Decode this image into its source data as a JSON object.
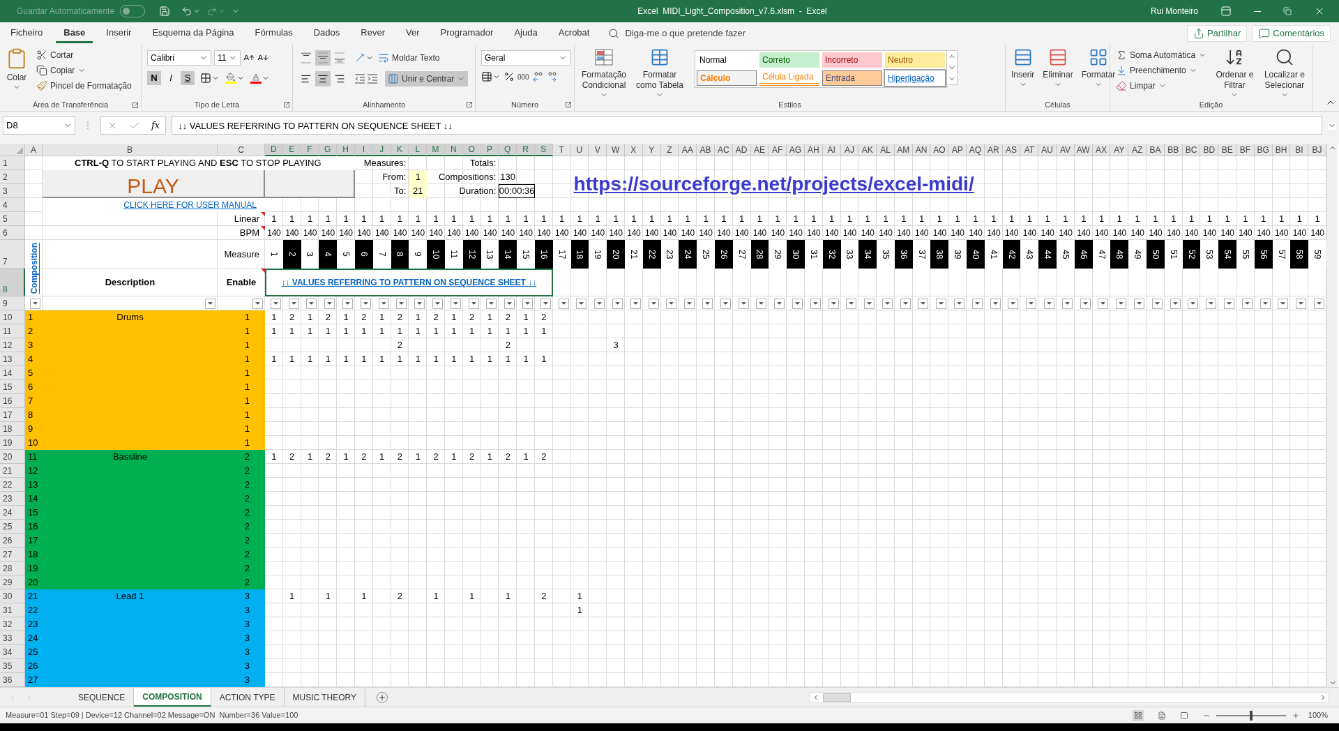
{
  "window": {
    "autosave_label": "Guardar Automaticamente",
    "autosave_on": false,
    "title": "Excel  MIDI_Light_Composition_v7.6.xlsm  -  Excel",
    "user": "Rui Monteiro"
  },
  "menu_tabs": [
    {
      "label": "Ficheiro",
      "selected": false
    },
    {
      "label": "Base",
      "selected": true
    },
    {
      "label": "Inserir",
      "selected": false
    },
    {
      "label": "Esquema da Página",
      "selected": false
    },
    {
      "label": "Fórmulas",
      "selected": false
    },
    {
      "label": "Dados",
      "selected": false
    },
    {
      "label": "Rever",
      "selected": false
    },
    {
      "label": "Ver",
      "selected": false
    },
    {
      "label": "Programador",
      "selected": false
    },
    {
      "label": "Ajuda",
      "selected": false
    },
    {
      "label": "Acrobat",
      "selected": false
    }
  ],
  "tell_me": {
    "placeholder": "Diga-me o que pretende fazer"
  },
  "share_button": "Partilhar",
  "comments_button": "Comentários",
  "ribbon": {
    "clipboard": {
      "title": "Área de Transferência",
      "paste": "Colar",
      "cut": "Cortar",
      "copy": "Copiar",
      "format_painter": "Pincel de Formatação"
    },
    "font": {
      "title": "Tipo de Letra",
      "family": "Calibri",
      "size": "11",
      "bold": "N",
      "bold_on": true,
      "italic": "I",
      "italic_on": false,
      "underline": "S",
      "underline_on": true
    },
    "alignment": {
      "title": "Alinhamento",
      "vertical": [
        {
          "kind": "top",
          "selected": false
        },
        {
          "kind": "middle",
          "selected": true
        },
        {
          "kind": "bottom",
          "selected": false
        }
      ],
      "horizontal": [
        {
          "kind": "left",
          "selected": false
        },
        {
          "kind": "center",
          "selected": true
        },
        {
          "kind": "right",
          "selected": false
        }
      ],
      "wrap": "Moldar Texto",
      "merge": "Unir e Centrar",
      "merge_on": true
    },
    "number": {
      "title": "Número",
      "format": "Geral",
      "thousands": "000"
    },
    "styles": {
      "title": "Estilos",
      "conditional": "Formatação Condicional",
      "as_table": "Formatar como Tabela",
      "gallery": [
        {
          "label": "Normal",
          "kind": "normal",
          "selected": false
        },
        {
          "label": "Correto",
          "kind": "good",
          "selected": false
        },
        {
          "label": "Incorreto",
          "kind": "bad",
          "selected": false
        },
        {
          "label": "Neutro",
          "kind": "neutral",
          "selected": false
        },
        {
          "label": "Cálculo",
          "kind": "calculation",
          "selected": false
        },
        {
          "label": "Célula Ligada",
          "kind": "linked",
          "selected": false
        },
        {
          "label": "Entrada",
          "kind": "input",
          "selected": false
        },
        {
          "label": "Hiperligação",
          "kind": "hyperlink",
          "selected": true
        }
      ]
    },
    "cells": {
      "title": "Células",
      "insert": "Inserir",
      "delete": "Eliminar",
      "format": "Formatar"
    },
    "editing": {
      "title": "Edição",
      "autosum": "Soma Automática",
      "fill": "Preenchimento",
      "clear": "Limpar",
      "sort": "Ordenar e Filtrar",
      "find": "Localizar e Selecionar"
    }
  },
  "formula_bar": {
    "name_box": "D8",
    "function_button": "fx",
    "value": "↓↓ VALUES REFERRING TO PATTERN ON SEQUENCE SHEET ↓↓"
  },
  "columns": [
    {
      "label": "A",
      "selected": false
    },
    {
      "label": "B",
      "selected": false
    },
    {
      "label": "C",
      "selected": false
    },
    {
      "label": "D",
      "selected": true
    },
    {
      "label": "E",
      "selected": true
    },
    {
      "label": "F",
      "selected": true
    },
    {
      "label": "G",
      "selected": true
    },
    {
      "label": "H",
      "selected": true
    },
    {
      "label": "I",
      "selected": true
    },
    {
      "label": "J",
      "selected": true
    },
    {
      "label": "K",
      "selected": true
    },
    {
      "label": "L",
      "selected": true
    },
    {
      "label": "M",
      "selected": true
    },
    {
      "label": "N",
      "selected": true
    },
    {
      "label": "O",
      "selected": true
    },
    {
      "label": "P",
      "selected": true
    },
    {
      "label": "Q",
      "selected": true
    },
    {
      "label": "R",
      "selected": true
    },
    {
      "label": "S",
      "selected": true
    },
    {
      "label": "T",
      "selected": false
    },
    {
      "label": "U",
      "selected": false
    },
    {
      "label": "V",
      "selected": false
    },
    {
      "label": "W",
      "selected": false
    },
    {
      "label": "X",
      "selected": false
    },
    {
      "label": "Y",
      "selected": false
    },
    {
      "label": "Z",
      "selected": false
    },
    {
      "label": "AA",
      "selected": false
    },
    {
      "label": "AB",
      "selected": false
    },
    {
      "label": "AC",
      "selected": false
    },
    {
      "label": "AD",
      "selected": false
    },
    {
      "label": "AE",
      "selected": false
    },
    {
      "label": "AF",
      "selected": false
    },
    {
      "label": "AG",
      "selected": false
    },
    {
      "label": "AH",
      "selected": false
    },
    {
      "label": "AI",
      "selected": false
    },
    {
      "label": "AJ",
      "selected": false
    },
    {
      "label": "AK",
      "selected": false
    },
    {
      "label": "AL",
      "selected": false
    },
    {
      "label": "AM",
      "selected": false
    },
    {
      "label": "AN",
      "selected": false
    },
    {
      "label": "AO",
      "selected": false
    },
    {
      "label": "AP",
      "selected": false
    },
    {
      "label": "AQ",
      "selected": false
    },
    {
      "label": "AR",
      "selected": false
    },
    {
      "label": "AS",
      "selected": false
    },
    {
      "label": "AT",
      "selected": false
    },
    {
      "label": "AU",
      "selected": false
    },
    {
      "label": "AV",
      "selected": false
    },
    {
      "label": "AW",
      "selected": false
    },
    {
      "label": "AX",
      "selected": false
    },
    {
      "label": "AY",
      "selected": false
    },
    {
      "label": "AZ",
      "selected": false
    },
    {
      "label": "BA",
      "selected": false
    },
    {
      "label": "BB",
      "selected": false
    },
    {
      "label": "BC",
      "selected": false
    },
    {
      "label": "BD",
      "selected": false
    },
    {
      "label": "BE",
      "selected": false
    },
    {
      "label": "BF",
      "selected": false
    },
    {
      "label": "BG",
      "selected": false
    },
    {
      "label": "BH",
      "selected": false
    },
    {
      "label": "BI",
      "selected": false
    },
    {
      "label": "BJ",
      "selected": false
    }
  ],
  "row_numbers": [
    {
      "label": "1",
      "selected": false
    },
    {
      "label": "2",
      "selected": false
    },
    {
      "label": "3",
      "selected": false
    },
    {
      "label": "4",
      "selected": false
    },
    {
      "label": "5",
      "selected": false
    },
    {
      "label": "6",
      "selected": false
    },
    {
      "label": "7",
      "selected": false
    },
    {
      "label": "8",
      "selected": true
    },
    {
      "label": "9",
      "selected": false
    },
    {
      "label": "10",
      "selected": false
    },
    {
      "label": "11",
      "selected": false
    },
    {
      "label": "12",
      "selected": false
    },
    {
      "label": "13",
      "selected": false
    },
    {
      "label": "14",
      "selected": false
    },
    {
      "label": "15",
      "selected": false
    },
    {
      "label": "16",
      "selected": false
    },
    {
      "label": "17",
      "selected": false
    },
    {
      "label": "18",
      "selected": false
    },
    {
      "label": "19",
      "selected": false
    },
    {
      "label": "20",
      "selected": false
    },
    {
      "label": "21",
      "selected": false
    },
    {
      "label": "22",
      "selected": false
    },
    {
      "label": "23",
      "selected": false
    },
    {
      "label": "24",
      "selected": false
    },
    {
      "label": "25",
      "selected": false
    },
    {
      "label": "26",
      "selected": false
    },
    {
      "label": "27",
      "selected": false
    },
    {
      "label": "28",
      "selected": false
    },
    {
      "label": "29",
      "selected": false
    },
    {
      "label": "30",
      "selected": false
    },
    {
      "label": "31",
      "selected": false
    },
    {
      "label": "32",
      "selected": false
    },
    {
      "label": "33",
      "selected": false
    },
    {
      "label": "34",
      "selected": false
    },
    {
      "label": "35",
      "selected": false
    },
    {
      "label": "36",
      "selected": false
    }
  ],
  "sheet": {
    "instruction": "**CTRL-Q** TO START PLAYING AND **ESC** TO STOP PLAYING",
    "play_button": "PLAY",
    "manual_link": "CLICK HERE FOR USER MANUAL",
    "url_link": "https://sourceforge.net/projects/excel-midi/",
    "measures_label": "Measures:",
    "from_label": "From:",
    "from_value": "1",
    "to_label": "To:",
    "to_value": "21",
    "totals_label": "Totals:",
    "compositions_label": "Compositions:",
    "compositions_value": "130",
    "duration_label": "Duration:",
    "duration_value": "00:00:36",
    "linear_label": "Linear",
    "bpm_label": "BPM",
    "measure_label": "Measure",
    "composition_link": "Composition",
    "description_header": "Description",
    "enable_header": "Enable",
    "pattern_note": "↓↓ VALUES REFERRING TO PATTERN ON SEQUENCE SHEET ↓↓",
    "linear": [
      "1",
      "1",
      "1",
      "1",
      "1",
      "1",
      "1",
      "1",
      "1",
      "1",
      "1",
      "1",
      "1",
      "1",
      "1",
      "1",
      "1",
      "1",
      "1",
      "1",
      "1",
      "1",
      "1",
      "1",
      "1",
      "1",
      "1",
      "1",
      "1",
      "1",
      "1",
      "1",
      "1",
      "1",
      "1",
      "1",
      "1",
      "1",
      "1",
      "1",
      "1",
      "1",
      "1",
      "1",
      "1",
      "1",
      "1",
      "1",
      "1",
      "1",
      "1",
      "1",
      "1",
      "1",
      "1",
      "1",
      "1",
      "1",
      "1"
    ],
    "bpm": [
      "140",
      "140",
      "140",
      "140",
      "140",
      "140",
      "140",
      "140",
      "140",
      "140",
      "140",
      "140",
      "140",
      "140",
      "140",
      "140",
      "140",
      "140",
      "140",
      "140",
      "140",
      "140",
      "140",
      "140",
      "140",
      "140",
      "140",
      "140",
      "140",
      "140",
      "140",
      "140",
      "140",
      "140",
      "140",
      "140",
      "140",
      "140",
      "140",
      "140",
      "140",
      "140",
      "140",
      "140",
      "140",
      "140",
      "140",
      "140",
      "140",
      "140",
      "140",
      "140",
      "140",
      "140",
      "140",
      "140",
      "140",
      "140",
      "140"
    ],
    "measures": [
      {
        "label": "1",
        "dark": false
      },
      {
        "label": "2",
        "dark": true
      },
      {
        "label": "3",
        "dark": false
      },
      {
        "label": "4",
        "dark": true
      },
      {
        "label": "5",
        "dark": false
      },
      {
        "label": "6",
        "dark": true
      },
      {
        "label": "7",
        "dark": false
      },
      {
        "label": "8",
        "dark": true
      },
      {
        "label": "9",
        "dark": false
      },
      {
        "label": "10",
        "dark": true
      },
      {
        "label": "11",
        "dark": false
      },
      {
        "label": "12",
        "dark": true
      },
      {
        "label": "13",
        "dark": false
      },
      {
        "label": "14",
        "dark": true
      },
      {
        "label": "15",
        "dark": false
      },
      {
        "label": "16",
        "dark": true
      },
      {
        "label": "17",
        "dark": false
      },
      {
        "label": "18",
        "dark": true
      },
      {
        "label": "19",
        "dark": false
      },
      {
        "label": "20",
        "dark": true
      },
      {
        "label": "21",
        "dark": false
      },
      {
        "label": "22",
        "dark": true
      },
      {
        "label": "23",
        "dark": false
      },
      {
        "label": "24",
        "dark": true
      },
      {
        "label": "25",
        "dark": false
      },
      {
        "label": "26",
        "dark": true
      },
      {
        "label": "27",
        "dark": false
      },
      {
        "label": "28",
        "dark": true
      },
      {
        "label": "29",
        "dark": false
      },
      {
        "label": "30",
        "dark": true
      },
      {
        "label": "31",
        "dark": false
      },
      {
        "label": "32",
        "dark": true
      },
      {
        "label": "33",
        "dark": false
      },
      {
        "label": "34",
        "dark": true
      },
      {
        "label": "35",
        "dark": false
      },
      {
        "label": "36",
        "dark": true
      },
      {
        "label": "37",
        "dark": false
      },
      {
        "label": "38",
        "dark": true
      },
      {
        "label": "39",
        "dark": false
      },
      {
        "label": "40",
        "dark": true
      },
      {
        "label": "41",
        "dark": false
      },
      {
        "label": "42",
        "dark": true
      },
      {
        "label": "43",
        "dark": false
      },
      {
        "label": "44",
        "dark": true
      },
      {
        "label": "45",
        "dark": false
      },
      {
        "label": "46",
        "dark": true
      },
      {
        "label": "47",
        "dark": false
      },
      {
        "label": "48",
        "dark": true
      },
      {
        "label": "49",
        "dark": false
      },
      {
        "label": "50",
        "dark": true
      },
      {
        "label": "51",
        "dark": false
      },
      {
        "label": "52",
        "dark": true
      },
      {
        "label": "53",
        "dark": false
      },
      {
        "label": "54",
        "dark": true
      },
      {
        "label": "55",
        "dark": false
      },
      {
        "label": "56",
        "dark": true
      },
      {
        "label": "57",
        "dark": false
      },
      {
        "label": "58",
        "dark": true
      },
      {
        "label": "59",
        "dark": false
      }
    ],
    "tracks": [
      {
        "number": "1",
        "description": "Drums",
        "enable": "1",
        "color": "#ffc000",
        "cells": [
          "1",
          "2",
          "1",
          "2",
          "1",
          "2",
          "1",
          "2",
          "1",
          "2",
          "1",
          "2",
          "1",
          "2",
          "1",
          "2"
        ]
      },
      {
        "number": "2",
        "enable": "1",
        "color": "#ffc000",
        "cells": [
          "1",
          "1",
          "1",
          "1",
          "1",
          "1",
          "1",
          "1",
          "1",
          "1",
          "1",
          "1",
          "1",
          "1",
          "1",
          "1"
        ]
      },
      {
        "number": "3",
        "enable": "1",
        "color": "#ffc000",
        "cells": [
          null,
          null,
          null,
          null,
          null,
          null,
          null,
          "2",
          null,
          null,
          null,
          null,
          null,
          "2",
          null,
          null,
          null,
          null,
          null,
          "3"
        ]
      },
      {
        "number": "4",
        "enable": "1",
        "color": "#ffc000",
        "cells": [
          "1",
          "1",
          "1",
          "1",
          "1",
          "1",
          "1",
          "1",
          "1",
          "1",
          "1",
          "1",
          "1",
          "1",
          "1",
          "1"
        ]
      },
      {
        "number": "5",
        "enable": "1",
        "color": "#ffc000"
      },
      {
        "number": "6",
        "enable": "1",
        "color": "#ffc000"
      },
      {
        "number": "7",
        "enable": "1",
        "color": "#ffc000"
      },
      {
        "number": "8",
        "enable": "1",
        "color": "#ffc000"
      },
      {
        "number": "9",
        "enable": "1",
        "color": "#ffc000"
      },
      {
        "number": "10",
        "enable": "1",
        "color": "#ffc000"
      },
      {
        "number": "11",
        "description": "Bassline",
        "enable": "2",
        "color": "#00b050",
        "cells": [
          "1",
          "2",
          "1",
          "2",
          "1",
          "2",
          "1",
          "2",
          "1",
          "2",
          "1",
          "2",
          "1",
          "2",
          "1",
          "2"
        ]
      },
      {
        "number": "12",
        "enable": "2",
        "color": "#00b050"
      },
      {
        "number": "13",
        "enable": "2",
        "color": "#00b050"
      },
      {
        "number": "14",
        "enable": "2",
        "color": "#00b050"
      },
      {
        "number": "15",
        "enable": "2",
        "color": "#00b050"
      },
      {
        "number": "16",
        "enable": "2",
        "color": "#00b050"
      },
      {
        "number": "17",
        "enable": "2",
        "color": "#00b050"
      },
      {
        "number": "18",
        "enable": "2",
        "color": "#00b050"
      },
      {
        "number": "19",
        "enable": "2",
        "color": "#00b050"
      },
      {
        "number": "20",
        "enable": "2",
        "color": "#00b050"
      },
      {
        "number": "21",
        "description": "Lead 1",
        "enable": "3",
        "color": "#00b0f0",
        "cells": [
          null,
          "1",
          null,
          "1",
          null,
          "1",
          null,
          "2",
          null,
          "1",
          null,
          "1",
          null,
          "1",
          null,
          "2",
          null,
          "1"
        ]
      },
      {
        "number": "22",
        "enable": "3",
        "color": "#00b0f0",
        "cells": [
          null,
          null,
          null,
          null,
          null,
          null,
          null,
          null,
          null,
          null,
          null,
          null,
          null,
          null,
          null,
          null,
          null,
          "1"
        ]
      },
      {
        "number": "23",
        "enable": "3",
        "color": "#00b0f0"
      },
      {
        "number": "24",
        "enable": "3",
        "color": "#00b0f0"
      },
      {
        "number": "25",
        "enable": "3",
        "color": "#00b0f0"
      },
      {
        "number": "26",
        "enable": "3",
        "color": "#00b0f0"
      },
      {
        "number": "27",
        "enable": "3",
        "color": "#00b0f0"
      }
    ]
  },
  "sheet_tabs": [
    {
      "label": "SEQUENCE",
      "selected": false
    },
    {
      "label": "COMPOSITION",
      "selected": true
    },
    {
      "label": "ACTION TYPE",
      "selected": false
    },
    {
      "label": "MUSIC THEORY",
      "selected": false
    }
  ],
  "status_bar": {
    "text": "Measure=01 Step=09 | Device=12 Channel=02 Message=ON  Number=36 Value=100",
    "zoom": {
      "level": 0.5,
      "label": "100%"
    }
  }
}
